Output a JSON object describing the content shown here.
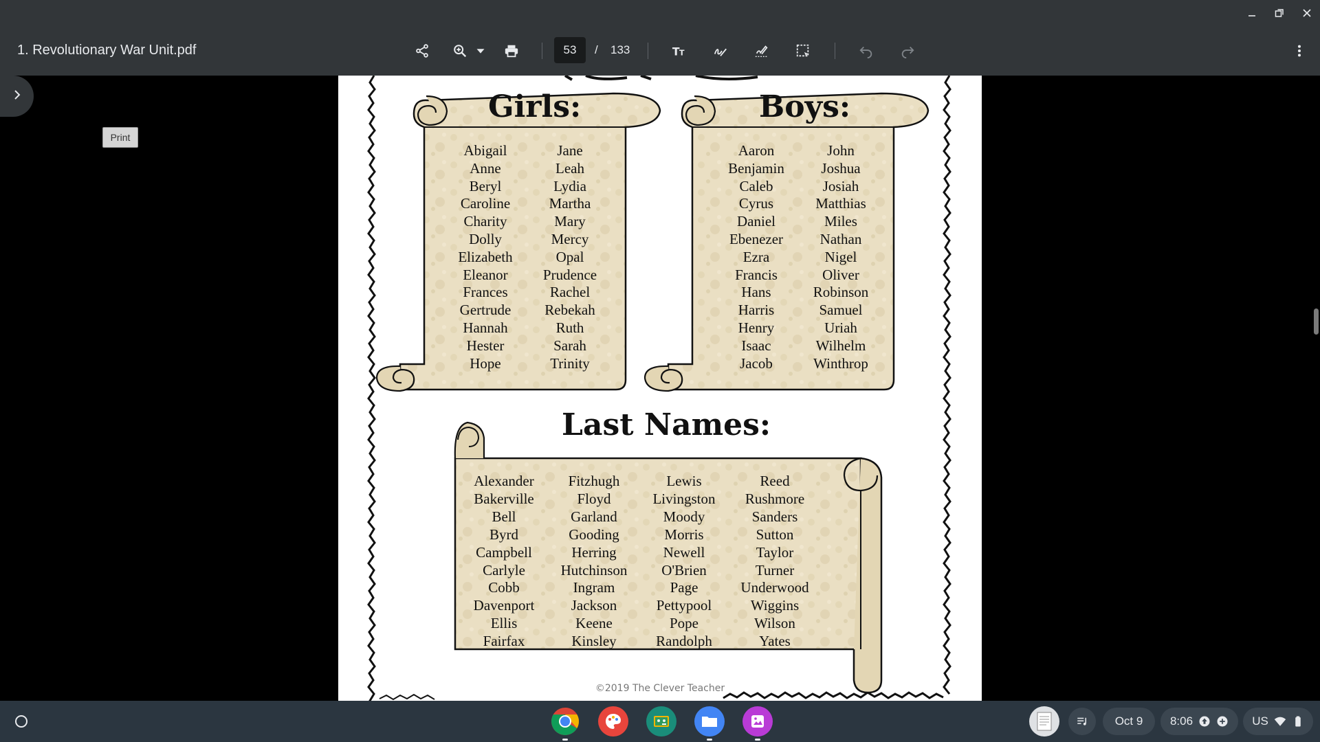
{
  "window": {
    "controls": [
      {
        "name": "minimize",
        "icon": "minimize-icon"
      },
      {
        "name": "restore",
        "icon": "restore-icon"
      },
      {
        "name": "close",
        "icon": "close-icon"
      }
    ]
  },
  "toolbar": {
    "title": "1. Revolutionary War Unit.pdf",
    "current_page": "53",
    "page_separator": "/",
    "total_pages": "133",
    "icons": [
      "share-icon",
      "zoom-icon",
      "print-icon",
      "text-icon",
      "draw-icon",
      "sign-icon",
      "selection-icon",
      "undo-icon",
      "redo-icon",
      "more-icon"
    ]
  },
  "sidebar": {
    "toggle_icon": "chevron-right-icon",
    "tooltip": "Print"
  },
  "document": {
    "girls_heading": "Girls:",
    "boys_heading": "Boys:",
    "last_heading": "Last Names:",
    "girls": [
      [
        "Abigail",
        "Anne",
        "Beryl",
        "Caroline",
        "Charity",
        "Dolly",
        "Elizabeth",
        "Eleanor",
        "Frances",
        "Gertrude",
        "Hannah",
        "Hester",
        "Hope"
      ],
      [
        "Jane",
        "Leah",
        "Lydia",
        "Martha",
        "Mary",
        "Mercy",
        "Opal",
        "Prudence",
        "Rachel",
        "Rebekah",
        "Ruth",
        "Sarah",
        "Trinity"
      ]
    ],
    "boys": [
      [
        "Aaron",
        "Benjamin",
        "Caleb",
        "Cyrus",
        "Daniel",
        "Ebenezer",
        "Ezra",
        "Francis",
        "Hans",
        "Harris",
        "Henry",
        "Isaac",
        "Jacob"
      ],
      [
        "John",
        "Joshua",
        "Josiah",
        "Matthias",
        "Miles",
        "Nathan",
        "Nigel",
        "Oliver",
        "Robinson",
        "Samuel",
        "Uriah",
        "Wilhelm",
        "Winthrop"
      ]
    ],
    "last_names": [
      [
        "Alexander",
        "Bakerville",
        "Bell",
        "Byrd",
        "Campbell",
        "Carlyle",
        "Cobb",
        "Davenport",
        "Ellis",
        "Fairfax"
      ],
      [
        "Fitzhugh",
        "Floyd",
        "Garland",
        "Gooding",
        "Herring",
        "Hutchinson",
        "Ingram",
        "Jackson",
        "Keene",
        "Kinsley"
      ],
      [
        "Lewis",
        "Livingston",
        "Moody",
        "Morris",
        "Newell",
        "O'Brien",
        "Page",
        "Pettypool",
        "Pope",
        "Randolph"
      ],
      [
        "Reed",
        "Rushmore",
        "Sanders",
        "Sutton",
        "Taylor",
        "Turner",
        "Underwood",
        "Wiggins",
        "Wilson",
        "Yates"
      ]
    ],
    "copyright": "©2019 The Clever Teacher"
  },
  "shelf": {
    "apps": [
      {
        "name": "chrome",
        "icon": "chrome-icon",
        "color": "#4285f4"
      },
      {
        "name": "canvas",
        "icon": "palette-icon",
        "color": "#e8453c"
      },
      {
        "name": "classroom",
        "icon": "classroom-icon",
        "color": "#1a8d7a"
      },
      {
        "name": "files",
        "icon": "folder-icon",
        "color": "#4285f4"
      },
      {
        "name": "gallery",
        "icon": "gallery-icon",
        "color": "#b93bd6"
      }
    ],
    "date": "Oct 9",
    "time": "8:06",
    "locale": "US"
  },
  "colors": {
    "toolbar": "#323639",
    "shelf": "#2b3640",
    "parchment": "#e9dcbd",
    "page_bg": "#000000"
  }
}
